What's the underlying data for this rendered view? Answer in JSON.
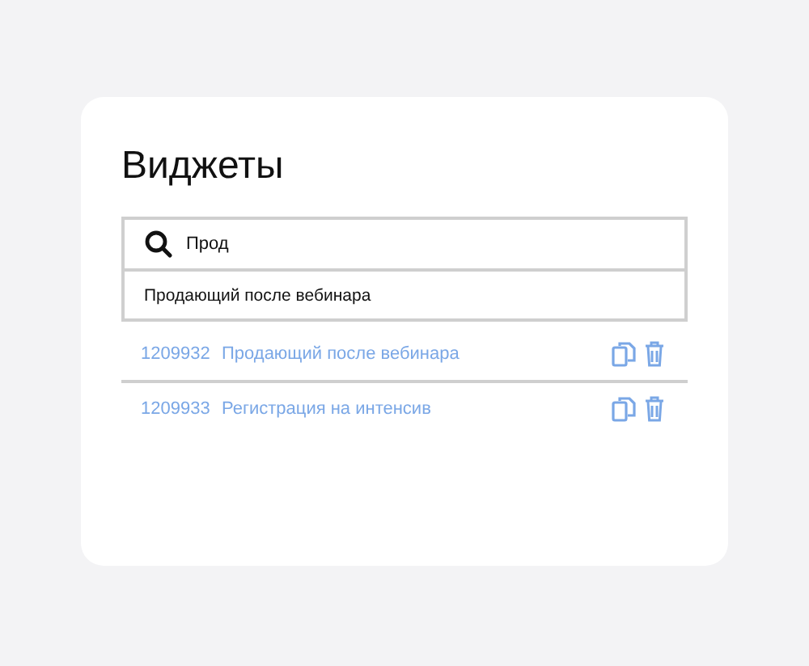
{
  "title": "Виджеты",
  "search": {
    "value": "Прод"
  },
  "suggestions": [
    "Продающий после вебинара"
  ],
  "widgets": [
    {
      "id": "1209932",
      "name": "Продающий после вебинара"
    },
    {
      "id": "1209933",
      "name": "Регистрация на интенсив"
    }
  ]
}
